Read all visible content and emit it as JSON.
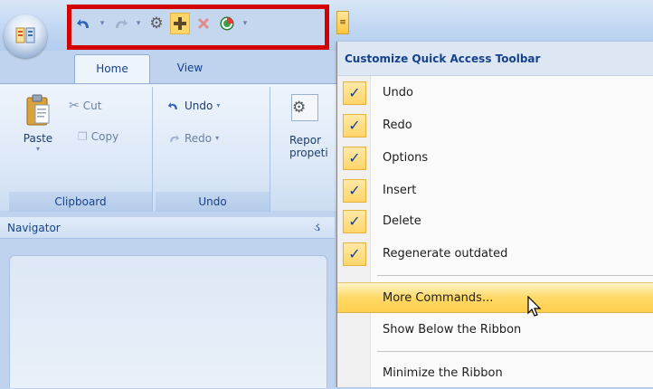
{
  "tabs": [
    {
      "label": "Home"
    },
    {
      "label": "View"
    }
  ],
  "quick_access": {
    "buttons": [
      {
        "icon": "undo-icon",
        "has_dropdown": true
      },
      {
        "icon": "redo-icon",
        "has_dropdown": true
      },
      {
        "icon": "gear-icon",
        "has_dropdown": false
      },
      {
        "icon": "plus-icon",
        "has_dropdown": false
      },
      {
        "icon": "delete-icon",
        "has_dropdown": false
      },
      {
        "icon": "regenerate-icon",
        "has_dropdown": true
      }
    ],
    "highlight_color": "#d40000"
  },
  "ribbon": {
    "clipboard": {
      "paste_label": "Paste",
      "cut_label": "Cut",
      "copy_label": "Copy",
      "group_label": "Clipboard"
    },
    "undo": {
      "undo_label": "Undo",
      "redo_label": "Redo",
      "group_label": "Undo"
    },
    "report": {
      "line1": "Repor",
      "line2": "propeti"
    }
  },
  "navigator": {
    "title": "Navigator",
    "pin_glyph": "ડ"
  },
  "menu": {
    "title": "Customize Quick Access Toolbar",
    "checked_items": [
      {
        "label": "Undo"
      },
      {
        "label": "Redo"
      },
      {
        "label": "Options"
      },
      {
        "label": "Insert"
      },
      {
        "label": "Delete"
      },
      {
        "label": "Regenerate outdated"
      }
    ],
    "more_commands": "More Commands...",
    "show_below": "Show Below the Ribbon",
    "minimize": "Minimize the Ribbon",
    "check_glyph": "✓"
  }
}
